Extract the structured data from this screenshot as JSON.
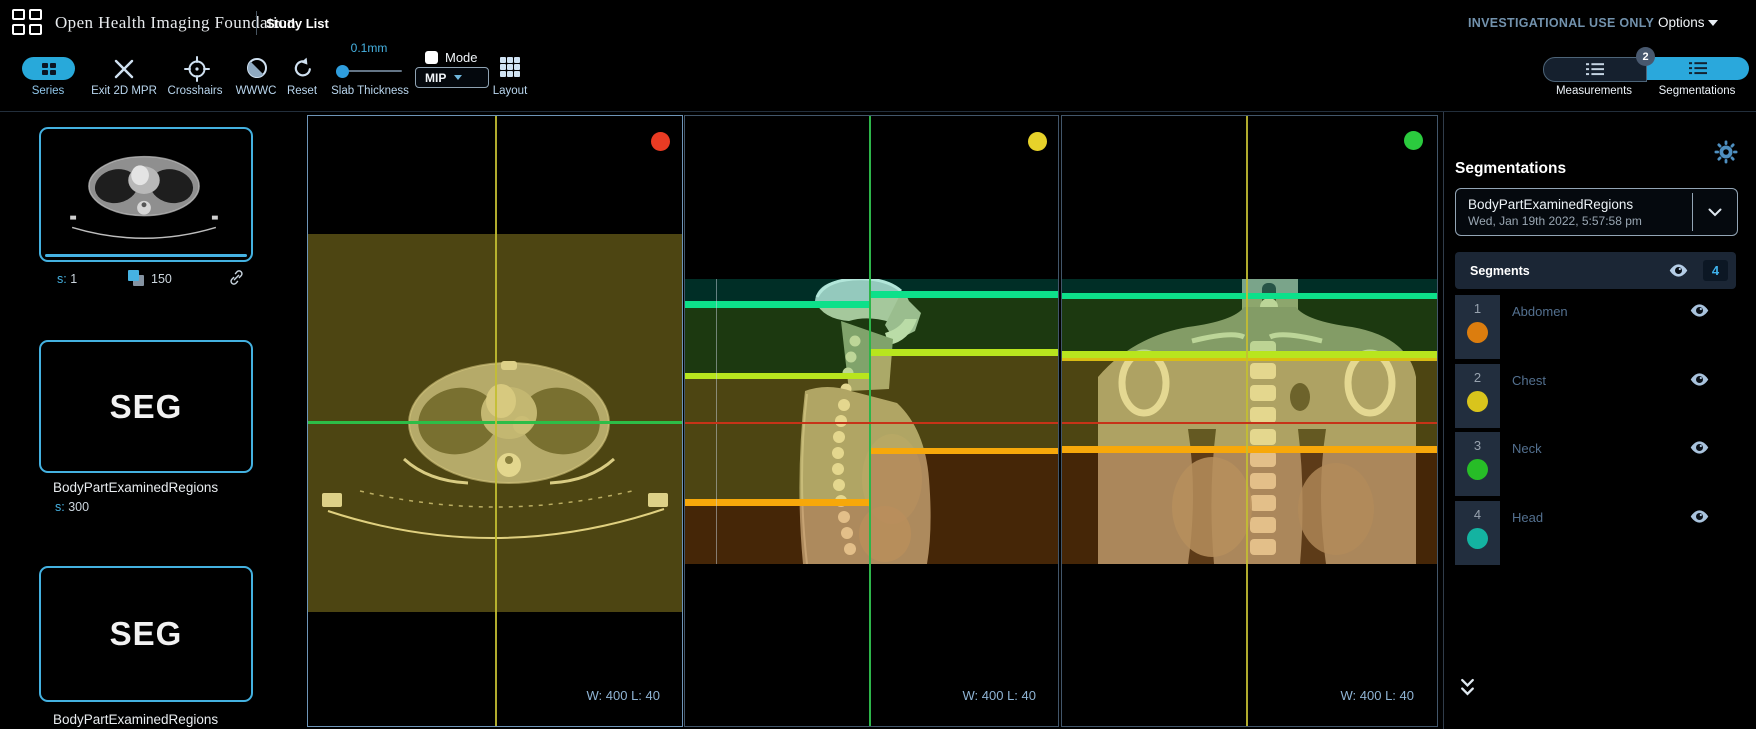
{
  "header": {
    "app_title": "Open Health Imaging Foundation",
    "study_list": "Study List",
    "investigational_label": "INVESTIGATIONAL USE ONLY",
    "options_label": "Options"
  },
  "toolbar": {
    "series_label": "Series",
    "exit_label": "Exit 2D MPR",
    "crosshairs_label": "Crosshairs",
    "wwwc_label": "WWWC",
    "reset_label": "Reset",
    "slab_value": "0.1mm",
    "slab_label": "Slab Thickness",
    "mode_label": "Mode",
    "mip_value": "MIP",
    "layout_label": "Layout",
    "measurements_label": "Measurements",
    "segmentations_label": "Segmentations",
    "segmentations_badge": "2"
  },
  "study_panel": {
    "thumbnails": [
      {
        "series_prefix": "s:",
        "series_number": "1",
        "instances": "150"
      },
      {
        "kind": "SEG",
        "description": "BodyPartExaminedRegions",
        "series_prefix": "s:",
        "series_number": "300"
      },
      {
        "kind": "SEG",
        "description": "BodyPartExaminedRegions"
      }
    ]
  },
  "viewports": [
    {
      "plane": "axial",
      "marker_color": "#ea3b23",
      "window_level": "W: 400 L: 40"
    },
    {
      "plane": "sagittal",
      "marker_color": "#e7d22a",
      "window_level": "W: 400 L: 40"
    },
    {
      "plane": "coronal",
      "marker_color": "#2bcb3e",
      "window_level": "W: 400 L: 40"
    }
  ],
  "segmentation_panel": {
    "title": "Segmentations",
    "active_segmentation": {
      "name": "BodyPartExaminedRegions",
      "date": "Wed, Jan 19th 2022, 5:57:58 pm"
    },
    "segments_label": "Segments",
    "segments_count": "4",
    "segments": [
      {
        "index": "1",
        "name": "Abdomen",
        "color": "#dc7d0e"
      },
      {
        "index": "2",
        "name": "Chest",
        "color": "#d9c41c"
      },
      {
        "index": "3",
        "name": "Neck",
        "color": "#27bd27"
      },
      {
        "index": "4",
        "name": "Head",
        "color": "#14b3a1"
      }
    ]
  }
}
